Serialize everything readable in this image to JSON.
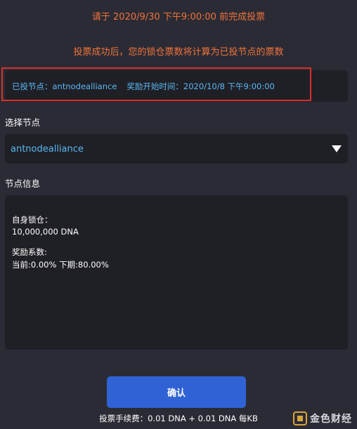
{
  "notices": {
    "deadline": "请于 2020/9/30 下午9:00:00 前完成投票",
    "success": "投票成功后，您的锁仓票数将计算为已投节点的票数"
  },
  "voted": {
    "node_label": "已投节点：",
    "node_value": "antnodealliance",
    "reward_label": "奖励开始时间：",
    "reward_value": "2020/10/8 下午9:00:00"
  },
  "select_section": {
    "label": "选择节点",
    "selected": "antnodealliance",
    "icon": "triangle-down-icon"
  },
  "info_section": {
    "label": "节点信息",
    "lock_label": "自身锁仓：",
    "lock_value": "10,000,000 DNA",
    "coef_label": "奖励系数:",
    "coef_value": "当前:0.00% 下期:80.00%"
  },
  "confirm_label": "确认",
  "fee_text": "投票手续费：0.01 DNA + 0.01 DNA 每KB",
  "watermark": {
    "text": "金色财经",
    "icon": "jinse-logo-icon"
  },
  "colors": {
    "background": "#2b2b35",
    "panel": "#1f1f26",
    "notice": "#f0743a",
    "link": "#5bb8f2",
    "highlight_border": "#d9302a",
    "button": "#2f62d4"
  }
}
